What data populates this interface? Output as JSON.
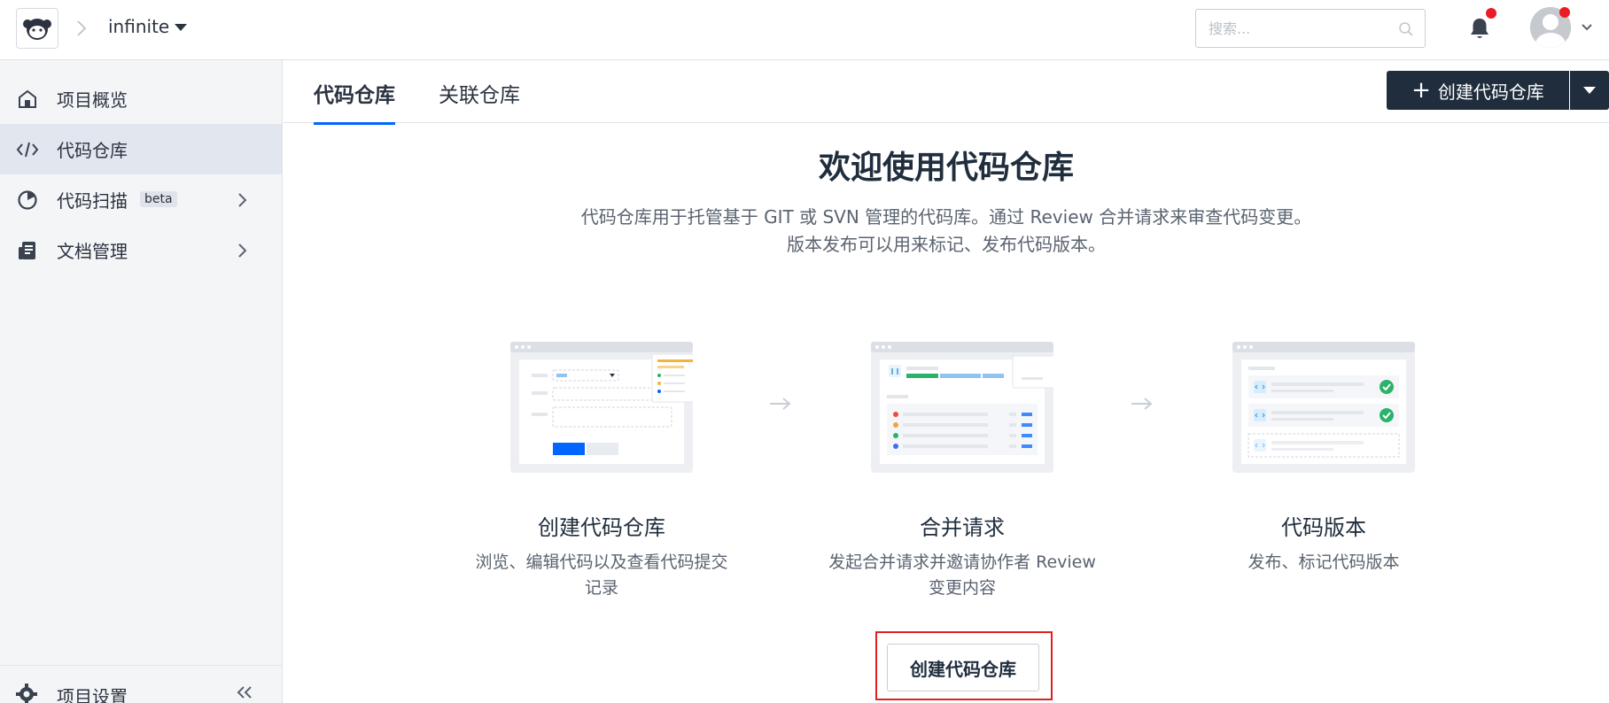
{
  "header": {
    "project_name": "infinite",
    "search_placeholder": "搜索...",
    "notification_dot_color": "#ec1c24"
  },
  "sidebar": {
    "items": [
      {
        "label": "项目概览",
        "icon": "home-icon",
        "active": false
      },
      {
        "label": "代码仓库",
        "icon": "code-icon",
        "active": true
      },
      {
        "label": "代码扫描",
        "icon": "scan-icon",
        "badge": "beta",
        "active": false,
        "has_submenu": true
      },
      {
        "label": "文档管理",
        "icon": "document-icon",
        "active": false,
        "has_submenu": true
      }
    ],
    "settings_label": "项目设置"
  },
  "tabs": [
    {
      "label": "代码仓库",
      "active": true
    },
    {
      "label": "关联仓库",
      "active": false
    }
  ],
  "create_button_label": "创建代码仓库",
  "welcome": {
    "title": "欢迎使用代码仓库",
    "desc_line1": "代码仓库用于托管基于 GIT 或 SVN 管理的代码库。通过 Review 合并请求来审查代码变更。",
    "desc_line2": "版本发布可以用来标记、发布代码版本。"
  },
  "cards": [
    {
      "title": "创建代码仓库",
      "desc_line1": "浏览、编辑代码以及查看代码提交",
      "desc_line2": "记录"
    },
    {
      "title": "合并请求",
      "desc_line1": "发起合并请求并邀请协作者 Review",
      "desc_line2": "变更内容"
    },
    {
      "title": "代码版本",
      "desc_line1": "发布、标记代码版本",
      "desc_line2": ""
    }
  ],
  "cta_label": "创建代码仓库",
  "colors": {
    "accent": "#0066ff",
    "dark_button": "#1f2d3d",
    "highlight_outline": "#e02020",
    "success": "#2bb36a"
  }
}
